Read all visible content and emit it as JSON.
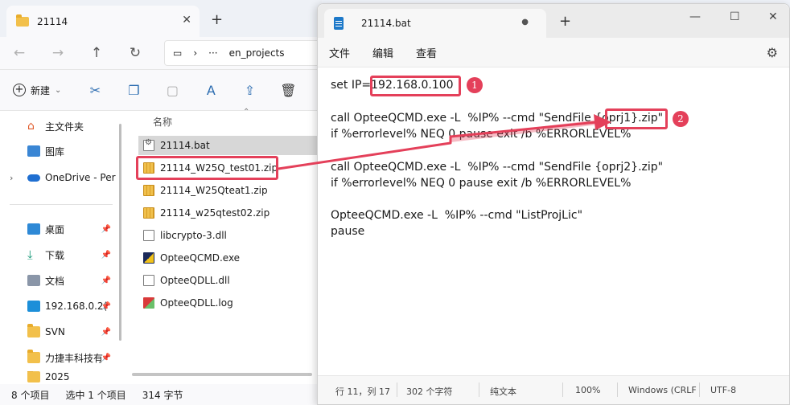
{
  "explorer": {
    "tab_title": "21114",
    "tab_close": "✕",
    "new_tab": "+",
    "address": {
      "more": "···",
      "path": "en_projects",
      "separator": "›"
    },
    "commands": {
      "new_label": "新建",
      "new_caret": "⌄"
    },
    "sidebar": {
      "items": [
        {
          "label": "主文件夹",
          "icon": "home-icon"
        },
        {
          "label": "图库",
          "icon": "gallery-icon"
        },
        {
          "label": "OneDrive - Per",
          "icon": "cloud-icon"
        },
        {
          "label": "桌面",
          "icon": "desktop-icon"
        },
        {
          "label": "下载",
          "icon": "download-icon"
        },
        {
          "label": "文档",
          "icon": "document-icon"
        },
        {
          "label": "192.168.0.2(",
          "icon": "monitor-icon"
        },
        {
          "label": "SVN",
          "icon": "folder-icon"
        },
        {
          "label": "力捷丰科技有",
          "icon": "folder-icon"
        },
        {
          "label": "2025",
          "icon": "folder-icon"
        }
      ],
      "pin_glyph": "📌"
    },
    "column_header": "名称",
    "files": [
      {
        "name": "21114.bat",
        "type": "bat"
      },
      {
        "name": "21114_W25Q_test01.zip",
        "type": "zip"
      },
      {
        "name": "21114_W25Qteat1.zip",
        "type": "zip"
      },
      {
        "name": "21114_w25qtest02.zip",
        "type": "zip"
      },
      {
        "name": "libcrypto-3.dll",
        "type": "dll"
      },
      {
        "name": "OpteeQCMD.exe",
        "type": "exe"
      },
      {
        "name": "OpteeQDLL.dll",
        "type": "dll"
      },
      {
        "name": "OpteeQDLL.log",
        "type": "log"
      }
    ],
    "status": {
      "count": "8 个项目",
      "selected": "选中 1 个项目",
      "size": "314 字节"
    }
  },
  "notepad": {
    "tab_title": "21114.bat",
    "new_tab": "+",
    "menu": [
      "文件",
      "编辑",
      "查看"
    ],
    "lines": [
      "set IP=192.168.0.100",
      "",
      "call OpteeQCMD.exe -L  %IP% --cmd \"SendFile {oprj1}.zip\"",
      "if %errorlevel% NEQ 0 pause exit /b %ERRORLEVEL%",
      "",
      "call OpteeQCMD.exe -L  %IP% --cmd \"SendFile {oprj2}.zip\"",
      "if %errorlevel% NEQ 0 pause exit /b %ERRORLEVEL%",
      "",
      "OpteeQCMD.exe -L  %IP% --cmd \"ListProjLic\"",
      "pause"
    ],
    "status": {
      "position": "行 11，列 17",
      "chars": "302 个字符",
      "format": "纯文本",
      "zoom": "100%",
      "line_ending": "Windows (CRLF",
      "encoding": "UTF-8"
    }
  },
  "annotations": {
    "badge_1": "1",
    "badge_2": "2",
    "color": "#e4405a"
  }
}
